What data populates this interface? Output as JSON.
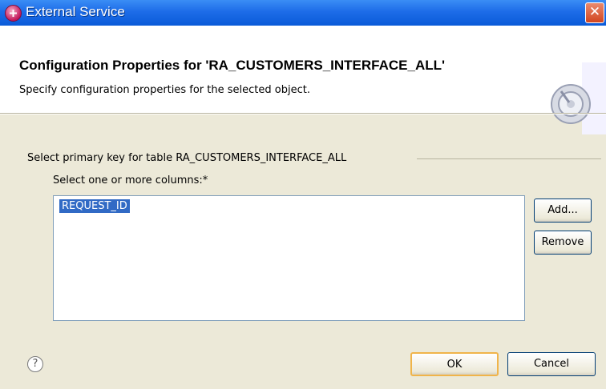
{
  "window": {
    "title": "External Service",
    "close_label": "✕"
  },
  "banner": {
    "title": "Configuration Properties for 'RA_CUSTOMERS_INTERFACE_ALL'",
    "description": "Specify configuration properties for the selected object."
  },
  "group": {
    "legend": "Select primary key for table RA_CUSTOMERS_INTERFACE_ALL",
    "columns_label": "Select one or more columns:*",
    "columns": [
      "REQUEST_ID"
    ],
    "add_label": "Add...",
    "remove_label": "Remove"
  },
  "footer": {
    "help_label": "?",
    "ok_label": "OK",
    "cancel_label": "Cancel"
  },
  "colors": {
    "title_bar": "#0a5bd8",
    "selection": "#316ac5",
    "dialog_bg": "#ece9d8"
  },
  "icons": {
    "app": "external-service-icon",
    "banner": "wizard-graphic-icon",
    "help": "help-icon",
    "close": "close-icon"
  }
}
